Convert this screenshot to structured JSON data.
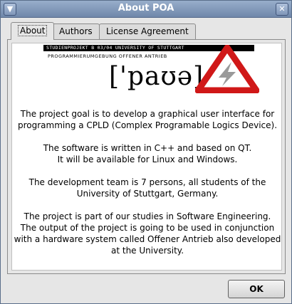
{
  "window": {
    "title": "About POA"
  },
  "tabs": [
    {
      "label": "About",
      "active": true
    },
    {
      "label": "Authors",
      "active": false
    },
    {
      "label": "License Agreement",
      "active": false
    }
  ],
  "about": {
    "banner": "STUDIENPROJEKT B 03/04 UNIVERSITY OF STUTTGART",
    "subbanner": "PROGRAMMIERUMGEBUNG OFFENER ANTRIEB",
    "logo_text": "['paʊə]",
    "paragraphs": [
      "The project goal is to develop a graphical user interface for\nprogramming a CPLD (Complex Programable Logics Device).",
      "The software is written in C++ and based on QT.\nIt will be available for Linux and Windows.",
      "The development team is 7 persons, all students of the\nUniversity of Stuttgart, Germany.",
      "The project is part of our studies in Software Engineering.\nThe output of the project is going to be used in conjunction\nwith a hardware system called Offener Antrieb also developed\nat the University."
    ]
  },
  "buttons": {
    "ok": "OK"
  },
  "icons": {
    "menu": "window-menu-icon",
    "close": "close-icon",
    "logo": "warning-triangle-lightning-icon"
  },
  "colors": {
    "logo_red": "#d01818",
    "titlebar": "#7f96b8"
  }
}
